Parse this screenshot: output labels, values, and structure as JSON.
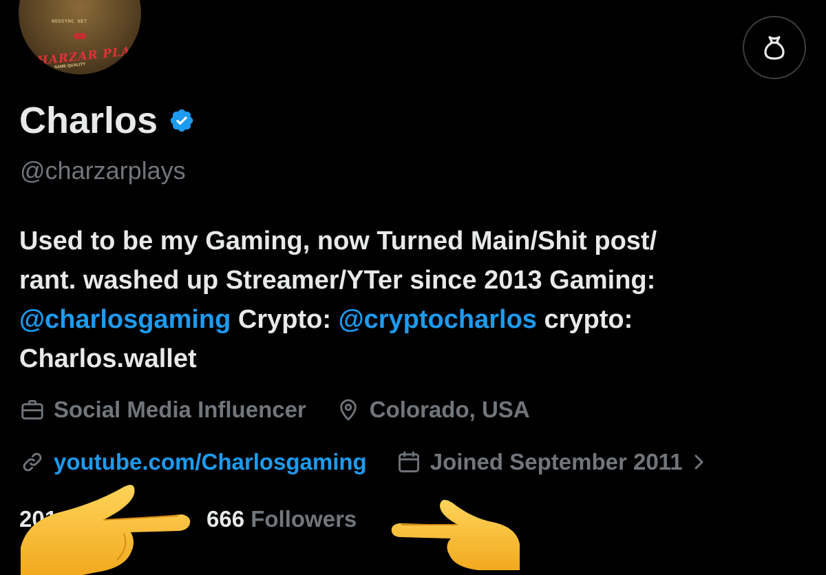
{
  "avatar": {
    "line1": "NEOSYNC NET",
    "line2": "",
    "banner": "CHARZAR PLAY",
    "tag": "SAME QUALITY"
  },
  "header": {
    "menu_icon": "money-bag-icon"
  },
  "profile": {
    "name": "Charlos",
    "verified_icon": "verified-badge-icon",
    "handle": "@charzarplays",
    "bio": {
      "line1": "Used to be my Gaming, now Turned Main/Shit post/",
      "line2": "rant. washed up Streamer/YTer since 2013 Gaming:",
      "mention1": "@charlosgaming",
      "crypto_label": " Crypto: ",
      "mention2": "@cryptocharlos",
      "crypto2_label": " crypto:",
      "line4": "Charlos.wallet"
    },
    "category_icon": "briefcase-icon",
    "category": "Social Media Influencer",
    "location_icon": "location-pin-icon",
    "location": "Colorado, USA",
    "link_icon": "link-icon",
    "website": "youtube.com/Charlosgaming",
    "joined_icon": "calendar-icon",
    "joined": "Joined September 2011",
    "joined_chevron": "chevron-right-icon"
  },
  "stats": {
    "following_partial": "201",
    "followers_count": "666",
    "followers_label": "Followers"
  },
  "overlays": {
    "left_emoji": "pointing-right-hand-emoji",
    "right_emoji": "pointing-left-hand-emoji"
  },
  "colors": {
    "background": "#000000",
    "text_primary": "#e7e9ea",
    "text_secondary": "#71767b",
    "accent_blue": "#1d9bf0"
  }
}
